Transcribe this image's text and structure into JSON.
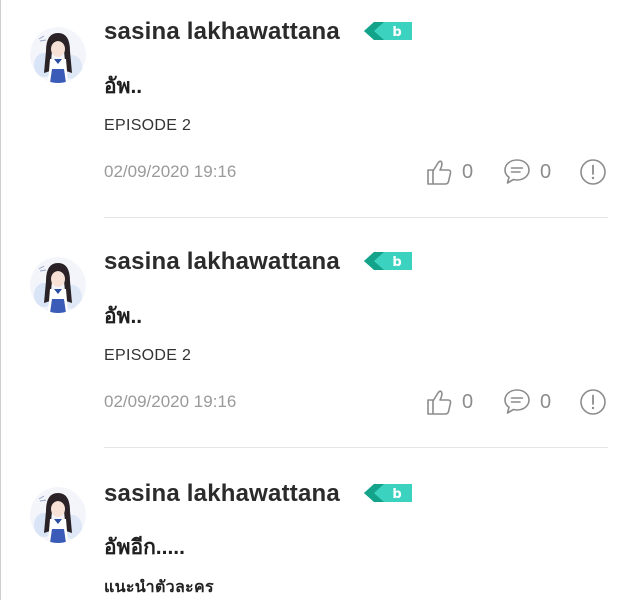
{
  "comments": [
    {
      "author": "sasina lakhawattana",
      "badge_letter": "b",
      "title": "อัพ..",
      "episode": "EPISODE 2",
      "timestamp": "02/09/2020 19:16",
      "likes": "0",
      "replies": "0"
    },
    {
      "author": "sasina lakhawattana",
      "badge_letter": "b",
      "title": "อัพ..",
      "episode": "EPISODE 2",
      "timestamp": "02/09/2020 19:16",
      "likes": "0",
      "replies": "0"
    },
    {
      "author": "sasina lakhawattana",
      "badge_letter": "b",
      "title": "อัพอีก.....",
      "episode": "แนะนำตัวละคร"
    }
  ],
  "colors": {
    "badge_dark": "#13a38a",
    "badge_light": "#3cd2c0",
    "icon_gray": "#8c8c8c",
    "timestamp_gray": "#9a9a9a"
  },
  "icons": {
    "like": "thumbs-up-icon",
    "reply": "speech-bubble-icon",
    "report": "exclamation-circle-icon"
  }
}
